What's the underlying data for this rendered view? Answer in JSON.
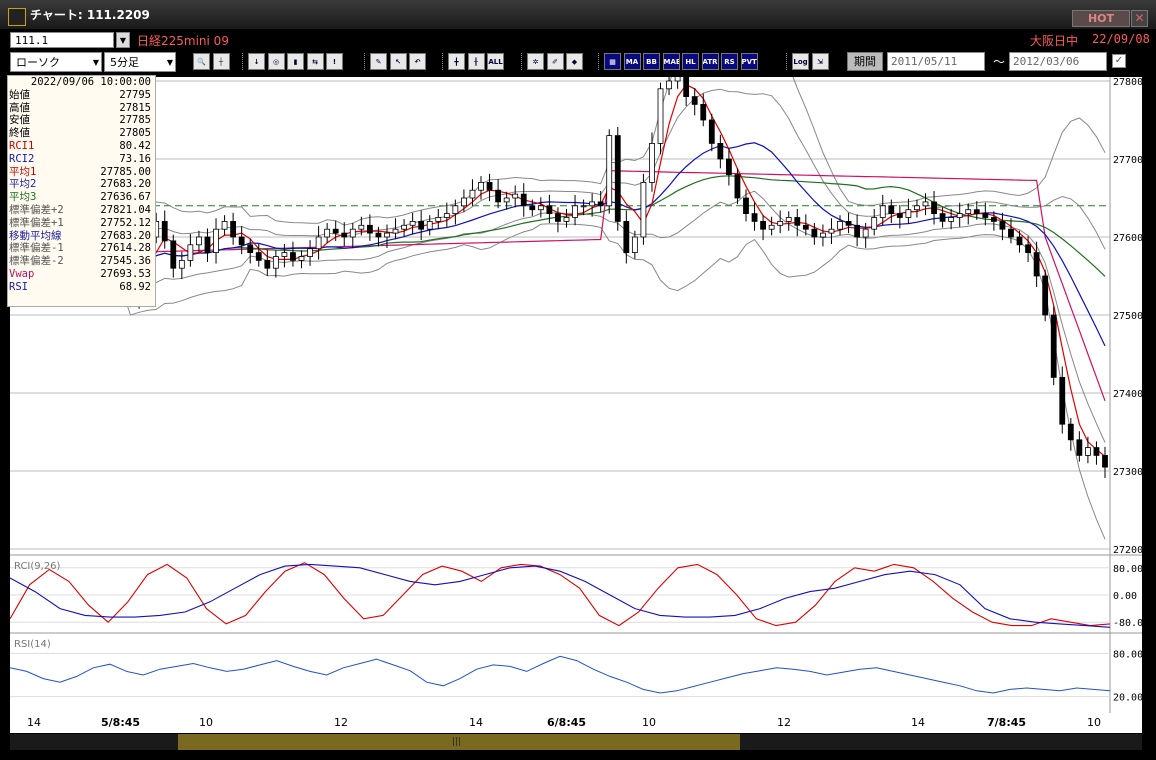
{
  "window": {
    "title": "チャート: 111.2209",
    "hot_label": "HOT",
    "close_label": "✕"
  },
  "info": {
    "symbol": "111.1",
    "instrument": "日経225mini 09",
    "session": "大阪日中",
    "date": "22/09/08"
  },
  "toolbar": {
    "chart_type": "ローソク",
    "timeframe": "5分足",
    "buttons_a": [
      "zoom-icon",
      "crosshair-icon"
    ],
    "buttons_b": [
      "download-icon",
      "magnify-icon",
      "bar-chart-icon",
      "split-icon",
      "alert-icon"
    ],
    "buttons_c": [
      "pencil-icon",
      "cursor-icon",
      "undo-icon"
    ],
    "buttons_d": [
      "candle-icon",
      "candle-alt-icon",
      "ALL"
    ],
    "buttons_e": [
      "settings-icon",
      "paint-icon",
      "color-icon"
    ],
    "buttons_f": [
      "ind-1",
      "MA",
      "BB",
      "MAE",
      "HL",
      "ATR",
      "RSI-box",
      "PVT"
    ],
    "buttons_g": [
      "Log",
      "export-icon"
    ],
    "period_label": "期間",
    "date_from": "2011/05/11",
    "tilde": "〜",
    "date_to": "2012/03/06"
  },
  "infobox": {
    "timestamp": "2022/09/06 10:00:00",
    "rows": [
      {
        "label": "始値",
        "value": "27795",
        "color": "#000"
      },
      {
        "label": "高値",
        "value": "27815",
        "color": "#000"
      },
      {
        "label": "安値",
        "value": "27785",
        "color": "#000"
      },
      {
        "label": "終値",
        "value": "27805",
        "color": "#000"
      },
      {
        "label": "RCI1",
        "value": "80.42",
        "color": "#d00000"
      },
      {
        "label": "RCI2",
        "value": "73.16",
        "color": "#1a1aa8"
      },
      {
        "label": "平均1",
        "value": "27785.00",
        "color": "#d00000"
      },
      {
        "label": "平均2",
        "value": "27683.20",
        "color": "#1a1aa8"
      },
      {
        "label": "平均3",
        "value": "27636.67",
        "color": "#207020"
      },
      {
        "label": "標準偏差+2",
        "value": "27821.04",
        "color": "#555"
      },
      {
        "label": "標準偏差+1",
        "value": "27752.12",
        "color": "#555"
      },
      {
        "label": "移動平均線",
        "value": "27683.20",
        "color": "#1a1aa8"
      },
      {
        "label": "標準偏差-1",
        "value": "27614.28",
        "color": "#555"
      },
      {
        "label": "標準偏差-2",
        "value": "27545.36",
        "color": "#555"
      },
      {
        "label": "Vwap",
        "value": "27693.53",
        "color": "#c01060"
      },
      {
        "label": "RSI",
        "value": "68.92",
        "color": "#1a1aa8"
      }
    ]
  },
  "panels": {
    "rci_label": "RCI(9,26)",
    "rsi_label": "RSI(14)"
  },
  "colors": {
    "up": "#ffffff",
    "down": "#000000",
    "ma_red": "#e00000",
    "ma_blue": "#1010c0",
    "ma_green": "#207020",
    "vwap": "#d01060",
    "band": "#888888",
    "dashed": "#208020",
    "rsi": "#2050d0"
  },
  "chart_data": [
    {
      "type": "candlestick",
      "name": "price",
      "ylim": [
        27200,
        27800
      ],
      "yticks": [
        "27800",
        "27700",
        "27600",
        "27500",
        "27400",
        "27300",
        "27200"
      ],
      "xticks": [
        "14",
        "5/8:45",
        "10",
        "12",
        "14",
        "6/8:45",
        "10",
        "12",
        "14",
        "7/8:45",
        "10"
      ],
      "dashed_level": 27640,
      "closes": [
        27560,
        27520,
        27580,
        27600,
        27620,
        27595,
        27560,
        27570,
        27590,
        27600,
        27580,
        27610,
        27620,
        27600,
        27590,
        27580,
        27570,
        27560,
        27575,
        27580,
        27570,
        27575,
        27585,
        27600,
        27610,
        27605,
        27600,
        27610,
        27615,
        27605,
        27600,
        27605,
        27610,
        27615,
        27620,
        27610,
        27620,
        27625,
        27630,
        27640,
        27650,
        27660,
        27670,
        27660,
        27645,
        27650,
        27655,
        27640,
        27635,
        27640,
        27630,
        27620,
        27625,
        27640,
        27640,
        27645,
        27640,
        27730,
        27620,
        27580,
        27600,
        27670,
        27720,
        27790,
        27800,
        27810,
        27780,
        27770,
        27750,
        27720,
        27700,
        27680,
        27650,
        27630,
        27620,
        27610,
        27615,
        27620,
        27625,
        27615,
        27610,
        27600,
        27605,
        27610,
        27620,
        27615,
        27600,
        27610,
        27625,
        27640,
        27630,
        27625,
        27635,
        27640,
        27645,
        27630,
        27620,
        27625,
        27630,
        27635,
        27630,
        27625,
        27620,
        27610,
        27600,
        27590,
        27580,
        27550,
        27500,
        27420,
        27360,
        27340,
        27320,
        27330,
        27320,
        27305
      ]
    },
    {
      "type": "line",
      "name": "RCI",
      "ylim": [
        -100,
        100
      ],
      "yticks": [
        "80.00",
        "0.00",
        "-80.00"
      ],
      "series": [
        {
          "name": "RCI1",
          "values": [
            -70,
            30,
            75,
            40,
            -30,
            -80,
            -20,
            60,
            90,
            50,
            -40,
            -85,
            -60,
            10,
            70,
            95,
            60,
            -10,
            -70,
            -60,
            0,
            60,
            85,
            70,
            40,
            80,
            90,
            85,
            60,
            20,
            -60,
            -90,
            -50,
            20,
            80,
            90,
            60,
            0,
            -70,
            -90,
            -80,
            -30,
            40,
            80,
            70,
            90,
            80,
            40,
            -10,
            -50,
            -80,
            -90,
            -90,
            -70,
            -80,
            -90,
            -85
          ]
        },
        {
          "name": "RCI2",
          "values": [
            50,
            10,
            -40,
            -60,
            -65,
            -65,
            -60,
            -50,
            -20,
            20,
            60,
            85,
            90,
            85,
            80,
            60,
            40,
            30,
            40,
            60,
            80,
            85,
            70,
            40,
            0,
            -40,
            -60,
            -65,
            -65,
            -60,
            -40,
            -10,
            10,
            20,
            40,
            60,
            70,
            60,
            30,
            -40,
            -70,
            -80,
            -85,
            -90,
            -95
          ]
        }
      ]
    },
    {
      "type": "line",
      "name": "RSI",
      "ylim": [
        0,
        100
      ],
      "yticks": [
        "80.00",
        "20.00"
      ],
      "series": [
        {
          "name": "RSI",
          "values": [
            60,
            55,
            45,
            40,
            48,
            60,
            65,
            55,
            50,
            58,
            62,
            66,
            60,
            55,
            58,
            64,
            70,
            62,
            55,
            50,
            60,
            66,
            72,
            64,
            56,
            40,
            35,
            45,
            58,
            64,
            62,
            55,
            66,
            76,
            70,
            58,
            48,
            40,
            30,
            25,
            28,
            34,
            40,
            46,
            52,
            56,
            60,
            58,
            55,
            50,
            54,
            58,
            60,
            55,
            50,
            45,
            40,
            35,
            28,
            25,
            30,
            32,
            30,
            28,
            32,
            30,
            28
          ]
        }
      ]
    }
  ]
}
